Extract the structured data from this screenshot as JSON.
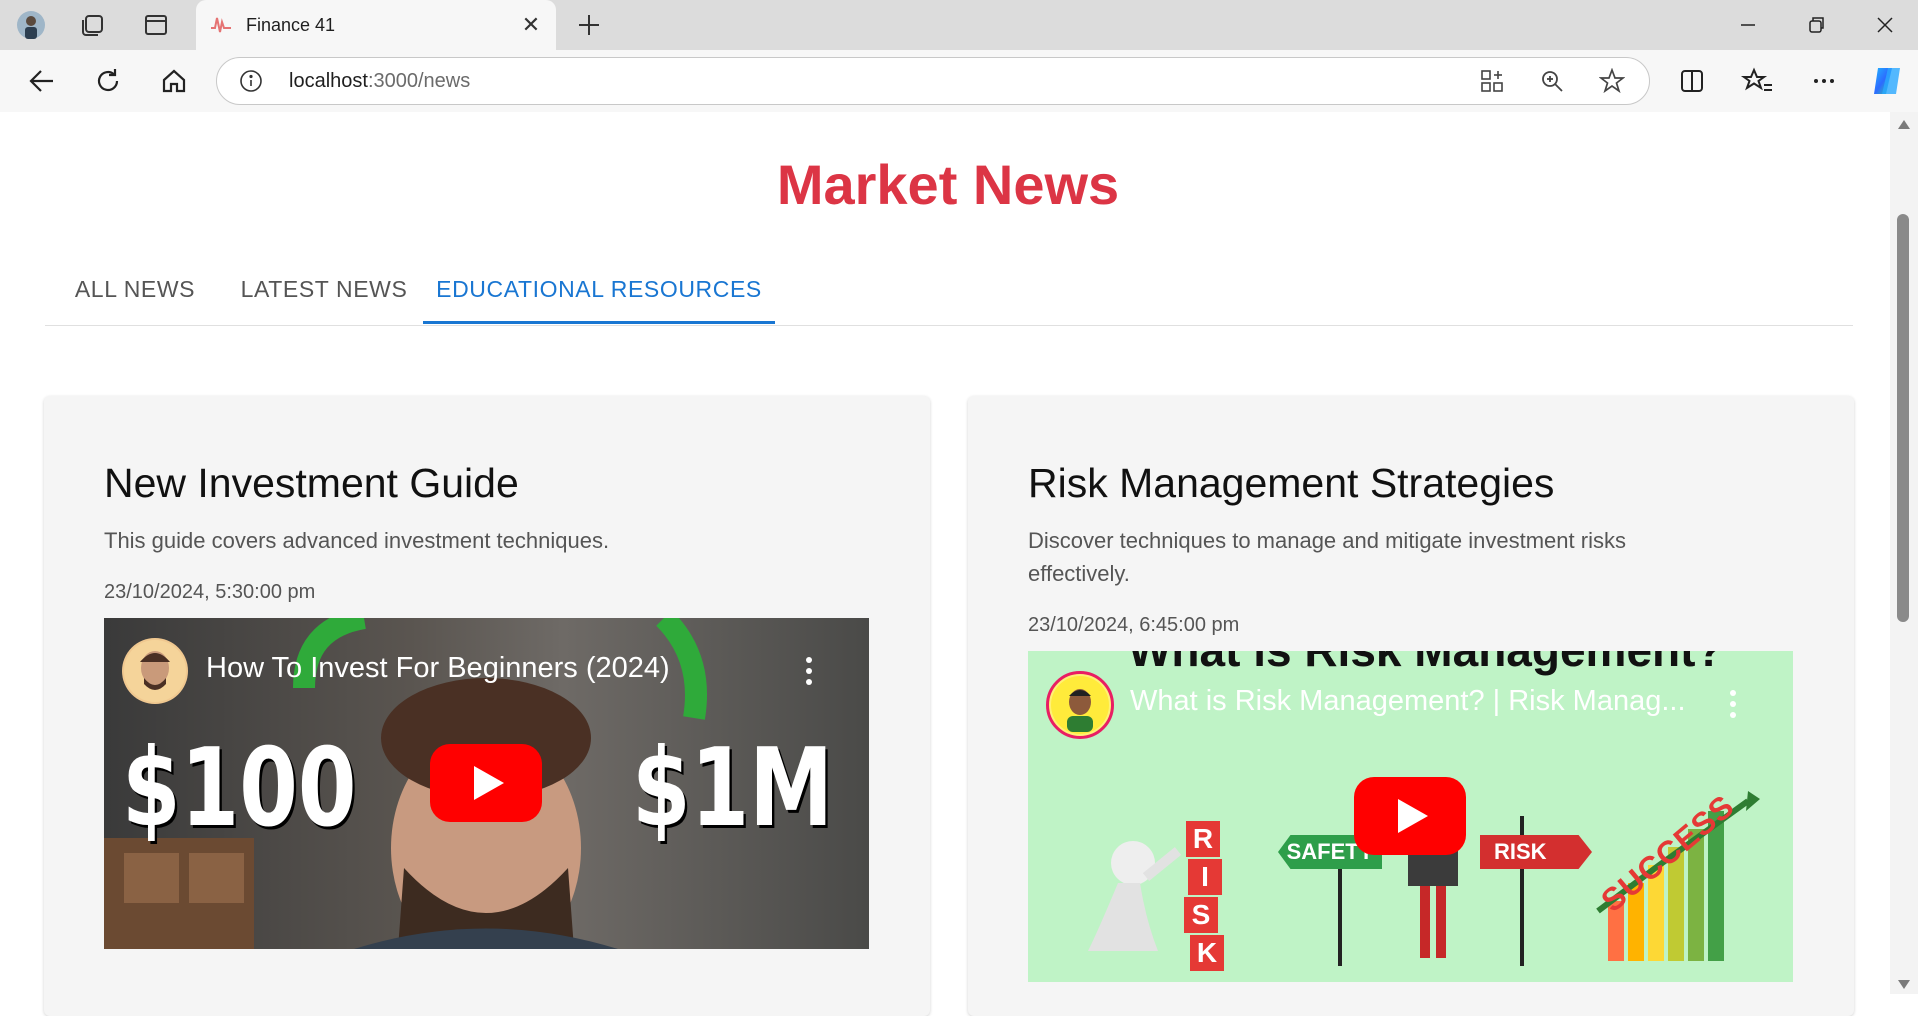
{
  "browser": {
    "tab_title": "Finance 41",
    "url_host": "localhost",
    "url_rest": ":3000/news"
  },
  "page": {
    "title": "Market News",
    "tabs": [
      {
        "label": "ALL NEWS",
        "active": false
      },
      {
        "label": "LATEST NEWS",
        "active": false
      },
      {
        "label": "EDUCATIONAL RESOURCES",
        "active": true
      }
    ],
    "cards": [
      {
        "title": "New Investment Guide",
        "description": "This guide covers advanced investment techniques.",
        "date": "23/10/2024, 5:30:00 pm",
        "video_title": "How To Invest For Beginners (2024)",
        "thumb_left": "$100",
        "thumb_right": "$1M"
      },
      {
        "title": "Risk Management Strategies",
        "description": "Discover techniques to manage and mitigate investment risks effectively.",
        "date": "23/10/2024, 6:45:00 pm",
        "video_title": "What is Risk Management? | Risk Manag...",
        "thumb_top": "What is Risk Management?",
        "sign_safety": "SAFETY",
        "sign_risk": "RISK",
        "risk_letters": [
          "R",
          "I",
          "S",
          "K"
        ],
        "success_text": "SUCCESS"
      }
    ]
  },
  "colors": {
    "title": "#dc3545",
    "active_tab": "#1976d2",
    "youtube_red": "#ff0000"
  }
}
